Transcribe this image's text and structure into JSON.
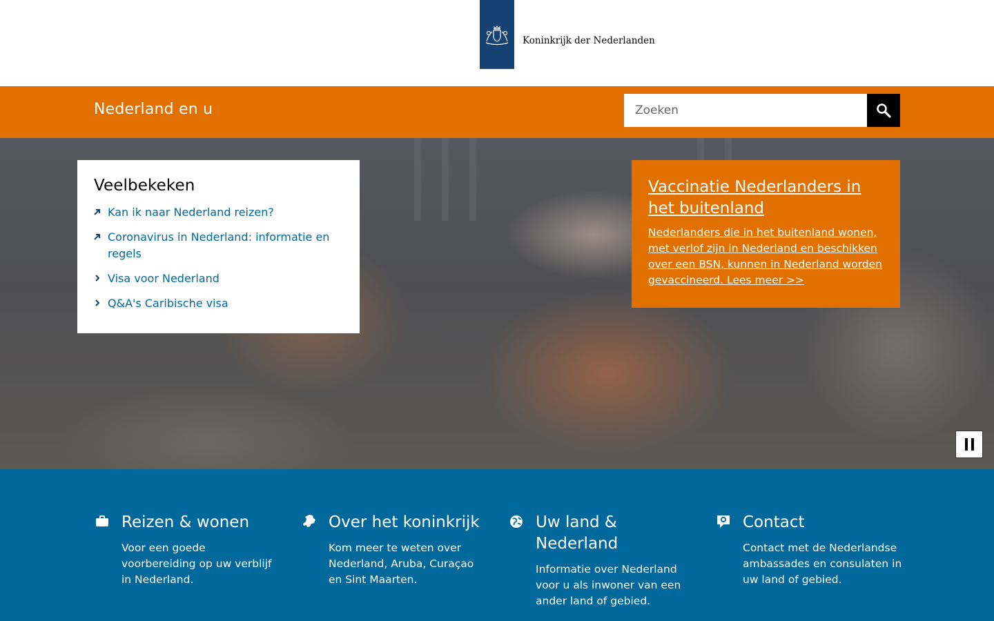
{
  "header": {
    "logo_text": "Koninkrijk der Nederlanden",
    "site_title": "Nederland en u",
    "search": {
      "placeholder": "Zoeken"
    }
  },
  "popular": {
    "heading": "Veelbekeken",
    "items": [
      {
        "label": "Kan ik naar Nederland reizen?",
        "icon": "external-arrow-icon"
      },
      {
        "label": "Coronavirus in Nederland: informatie en regels",
        "icon": "external-arrow-icon"
      },
      {
        "label": "Visa voor Nederland",
        "icon": "chevron-right-icon"
      },
      {
        "label": "Q&A's Caribische visa",
        "icon": "chevron-right-icon"
      }
    ]
  },
  "feature": {
    "title": "Vaccinatie Nederlanders in het buitenland",
    "text": "Nederlanders die in het buitenland wonen, met verlof zijn in Nederland en beschikken over een BSN, kunnen in Nederland worden gevaccineerd. Lees meer >>"
  },
  "tiles": [
    {
      "title": "Reizen & wonen",
      "text": "Voor een goede voorbereiding op uw verblijf in Nederland.",
      "icon": "suitcase-icon"
    },
    {
      "title": "Over het koninkrijk",
      "text": "Kom meer te weten over Nederland, Aruba, Curaçao en Sint Maarten.",
      "icon": "netherlands-map-icon"
    },
    {
      "title": "Uw land & Nederland",
      "text": "Informatie over Nederland voor u als inwoner van een ander land of gebied.",
      "icon": "globe-icon"
    },
    {
      "title": "Contact",
      "text": "Contact met de Nederlandse ambassades en consulaten in uw land of gebied.",
      "icon": "contact-speech-icon"
    }
  ],
  "colors": {
    "orange": "#e17000",
    "blue": "#01689b",
    "logo_blue": "#154273"
  }
}
